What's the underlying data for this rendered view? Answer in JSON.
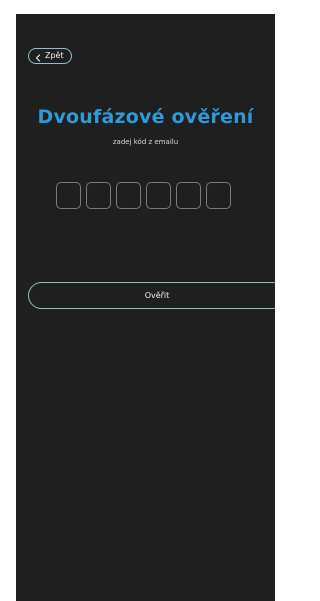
{
  "header": {
    "back_label": "Zpět"
  },
  "main": {
    "title": "Dvoufázové ověření",
    "subtitle": "zadej kód z emailu",
    "code_length": 6,
    "verify_label": "Ověřit"
  },
  "colors": {
    "background": "#1f1f1f",
    "accent": "#2e9ad8",
    "outline": "#8fbfc6"
  }
}
